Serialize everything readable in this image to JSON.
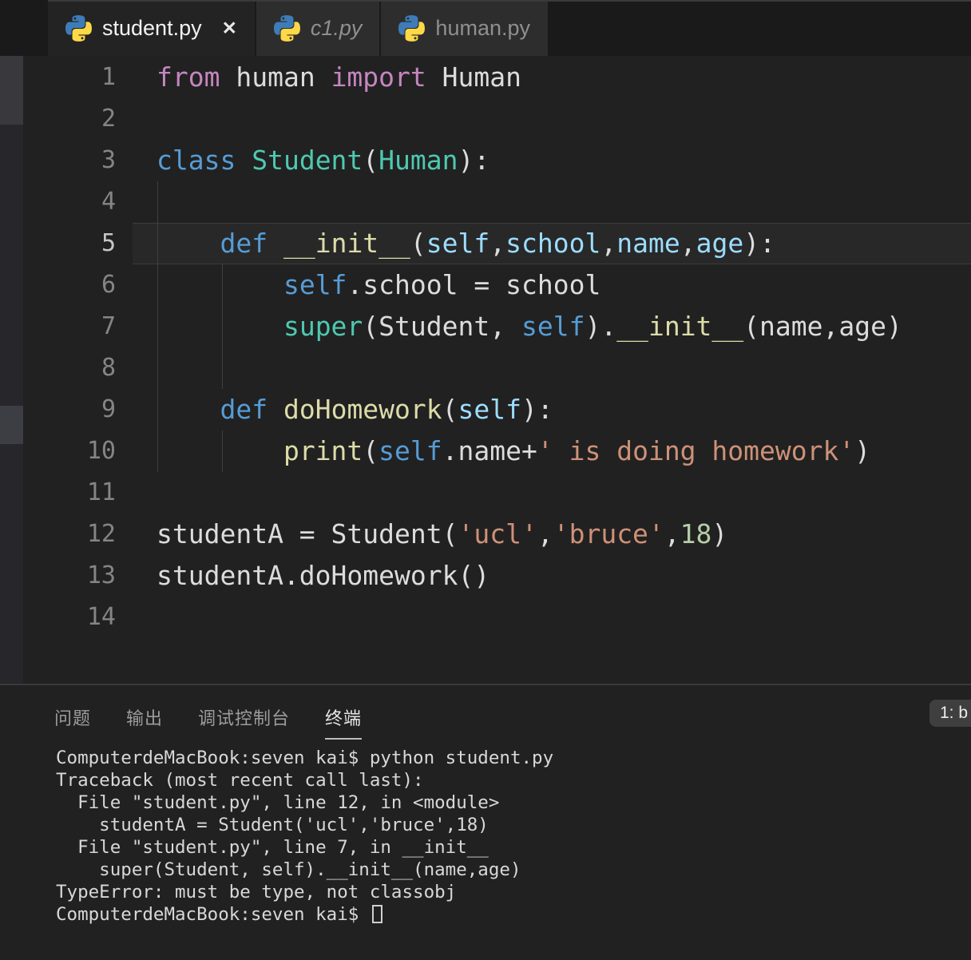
{
  "tab_bar": {
    "close_icon": "✕",
    "tabs": [
      {
        "label": "student.py",
        "active": true,
        "italic": false
      },
      {
        "label": "c1.py",
        "active": false,
        "italic": true
      },
      {
        "label": "human.py",
        "active": false,
        "italic": false
      }
    ]
  },
  "editor": {
    "cursor_line": "5",
    "lines": [
      {
        "num": "1",
        "tokens": [
          {
            "t": "from",
            "c": "kw2"
          },
          {
            "t": " human ",
            "c": "fg"
          },
          {
            "t": "import",
            "c": "kw2"
          },
          {
            "t": " Human",
            "c": "fg"
          }
        ]
      },
      {
        "num": "2",
        "tokens": []
      },
      {
        "num": "3",
        "tokens": [
          {
            "t": "class",
            "c": "kw"
          },
          {
            "t": " ",
            "c": "fg"
          },
          {
            "t": "Student",
            "c": "cls"
          },
          {
            "t": "(",
            "c": "fg"
          },
          {
            "t": "Human",
            "c": "cls"
          },
          {
            "t": "):",
            "c": "fg"
          }
        ]
      },
      {
        "num": "4",
        "tokens": []
      },
      {
        "num": "5",
        "active": true,
        "tokens": [
          {
            "t": "    ",
            "c": "fg"
          },
          {
            "t": "def",
            "c": "kw"
          },
          {
            "t": " ",
            "c": "fg"
          },
          {
            "t": "__init__",
            "c": "fn"
          },
          {
            "t": "(",
            "c": "fg"
          },
          {
            "t": "self",
            "c": "par"
          },
          {
            "t": ",",
            "c": "fg"
          },
          {
            "t": "school",
            "c": "par"
          },
          {
            "t": ",",
            "c": "fg"
          },
          {
            "t": "name",
            "c": "par"
          },
          {
            "t": ",",
            "c": "fg"
          },
          {
            "t": "age",
            "c": "par"
          },
          {
            "t": "):",
            "c": "fg"
          }
        ]
      },
      {
        "num": "6",
        "tokens": [
          {
            "t": "        ",
            "c": "fg"
          },
          {
            "t": "self",
            "c": "slf"
          },
          {
            "t": ".school = school",
            "c": "fg"
          }
        ]
      },
      {
        "num": "7",
        "tokens": [
          {
            "t": "        ",
            "c": "fg"
          },
          {
            "t": "super",
            "c": "cls"
          },
          {
            "t": "(Student, ",
            "c": "fg"
          },
          {
            "t": "self",
            "c": "slf"
          },
          {
            "t": ").",
            "c": "fg"
          },
          {
            "t": "__init__",
            "c": "fn"
          },
          {
            "t": "(name,age)",
            "c": "fg"
          }
        ]
      },
      {
        "num": "8",
        "tokens": []
      },
      {
        "num": "9",
        "tokens": [
          {
            "t": "    ",
            "c": "fg"
          },
          {
            "t": "def",
            "c": "kw"
          },
          {
            "t": " ",
            "c": "fg"
          },
          {
            "t": "doHomework",
            "c": "fn"
          },
          {
            "t": "(",
            "c": "fg"
          },
          {
            "t": "self",
            "c": "par"
          },
          {
            "t": "):",
            "c": "fg"
          }
        ]
      },
      {
        "num": "10",
        "tokens": [
          {
            "t": "        ",
            "c": "fg"
          },
          {
            "t": "print",
            "c": "fn"
          },
          {
            "t": "(",
            "c": "fg"
          },
          {
            "t": "self",
            "c": "slf"
          },
          {
            "t": ".name+",
            "c": "fg"
          },
          {
            "t": "' is doing homework'",
            "c": "str"
          },
          {
            "t": ")",
            "c": "fg"
          }
        ]
      },
      {
        "num": "11",
        "tokens": []
      },
      {
        "num": "12",
        "tokens": [
          {
            "t": "studentA = Student(",
            "c": "fg"
          },
          {
            "t": "'ucl'",
            "c": "str"
          },
          {
            "t": ",",
            "c": "fg"
          },
          {
            "t": "'bruce'",
            "c": "str"
          },
          {
            "t": ",",
            "c": "fg"
          },
          {
            "t": "18",
            "c": "num"
          },
          {
            "t": ")",
            "c": "fg"
          }
        ]
      },
      {
        "num": "13",
        "tokens": [
          {
            "t": "studentA.doHomework()",
            "c": "fg"
          }
        ]
      },
      {
        "num": "14",
        "tokens": []
      }
    ]
  },
  "panel": {
    "tabs": [
      {
        "label": "问题",
        "active": false
      },
      {
        "label": "输出",
        "active": false
      },
      {
        "label": "调试控制台",
        "active": false
      },
      {
        "label": "终端",
        "active": true
      }
    ],
    "dropdown_label": "1: b",
    "terminal_lines": [
      {
        "text": "ComputerdeMacBook:seven kai$ python student.py"
      },
      {
        "text": "Traceback (most recent call last):"
      },
      {
        "text": "  File \"student.py\", line 12, in <module>"
      },
      {
        "text": "    studentA = Student('ucl','bruce',18)"
      },
      {
        "text": "  File \"student.py\", line 7, in __init__"
      },
      {
        "text": "    super(Student, self).__init__(name,age)"
      },
      {
        "text": "TypeError: must be type, not classobj"
      },
      {
        "text": "ComputerdeMacBook:seven kai$ ",
        "cursor": true
      }
    ]
  },
  "colors": {
    "editor_background": "#212121",
    "tabbar_background": "#1a1a1a",
    "inactive_tab_background": "#2d2d2d",
    "keyword": "#569CD6",
    "control_keyword": "#C586C0",
    "class_name": "#4EC9B0",
    "function_name": "#DCDCAA",
    "parameter": "#9CDCFE",
    "self_keyword": "#569CD6",
    "string": "#CE9178",
    "number": "#B5CEA8",
    "foreground": "#DCDCDC",
    "line_number": "#858585",
    "python_icon_blue": "#3E7CB8",
    "python_icon_yellow": "#FFD848"
  }
}
